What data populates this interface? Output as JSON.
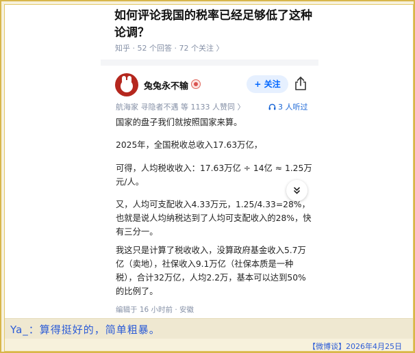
{
  "question": {
    "title": "如何评论我国的税率已经足够低了这种论调？",
    "meta": "知乎 · 52 个回答 · 72 个关注 〉"
  },
  "answer": {
    "author": "兔兔永不输",
    "follow_label": "+ 关注",
    "author_meta": "航海家 寻隐者不遇 等 1133 人赞同 〉",
    "listen_label": "3 人听过",
    "paragraphs": [
      "国家的盘子我们就按照国家来算。",
      "2025年，全国税收总收入17.63万亿，",
      "可得，人均税收收入：17.63万亿 ÷ 14亿 ≈ 1.25万元/人。",
      "又，人均可支配收入4.33万元，1.25/4.33=28%，也就是说人均纳税达到了人均可支配收入的28%，快有三分一。",
      "我这只是计算了税收收入，没算政府基金收入5.7万亿（卖地），社保收入9.1万亿（社保本质是一种税），合计32万亿，人均2.2万，基本可以达到50%的比例了。"
    ],
    "edit_meta": "编辑于 16 小时前 · 安徽"
  },
  "caption": {
    "comment": "Ya_：算得挺好的，简单粗暴。",
    "source": "【微博谈】2026年4月25日"
  },
  "icons": {
    "share": "share-icon",
    "collapse": "chevron-double-down-icon",
    "headphones": "headphones-icon",
    "badge": "badge-icon"
  },
  "colors": {
    "accent": "#0066ff",
    "meta_gray": "#8590a6",
    "caption_blue": "#2b5bd7",
    "frame_gold": "#d8b64a"
  }
}
